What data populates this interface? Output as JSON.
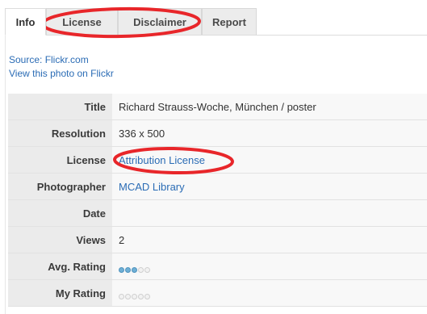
{
  "tabs": [
    {
      "label": "Info",
      "active": true
    },
    {
      "label": "License",
      "active": false
    },
    {
      "label": "Disclaimer",
      "active": false
    },
    {
      "label": "Report",
      "active": false
    }
  ],
  "source": {
    "source_text": "Source: Flickr.com",
    "view_link": "View this photo on Flickr"
  },
  "details": {
    "title_label": "Title",
    "title_value": "Richard Strauss-Woche, München / poster",
    "resolution_label": "Resolution",
    "resolution_value": "336 x 500",
    "license_label": "License",
    "license_value": "Attribution License",
    "photographer_label": "Photographer",
    "photographer_value": "MCAD Library",
    "date_label": "Date",
    "date_value": "",
    "views_label": "Views",
    "views_value": "2",
    "avg_rating_label": "Avg. Rating",
    "avg_rating_value": 3,
    "my_rating_label": "My Rating",
    "my_rating_value": 0,
    "rating_max": 5
  },
  "annotation_color": "#e8262a"
}
